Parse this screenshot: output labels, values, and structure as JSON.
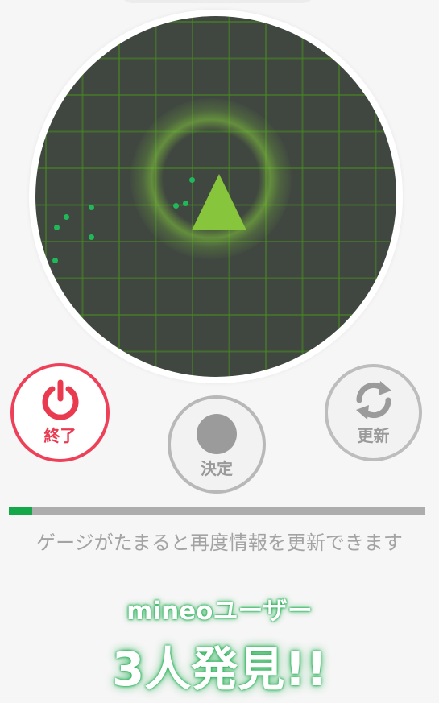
{
  "buttons": {
    "end_label": "終了",
    "decide_label": "決定",
    "refresh_label": "更新"
  },
  "gauge": {
    "progress": 0.057,
    "hint": "ゲージがたまると再度情報を更新できます"
  },
  "result": {
    "subtitle": "mineoユーザー",
    "headline": "3人発見!!"
  },
  "colors": {
    "accent_green": "#15a84a",
    "end_red": "#ee4058",
    "radar_bg": "#404740"
  },
  "icons": [
    "power-icon",
    "record-dot-icon",
    "refresh-icon",
    "heading-arrow-icon"
  ]
}
